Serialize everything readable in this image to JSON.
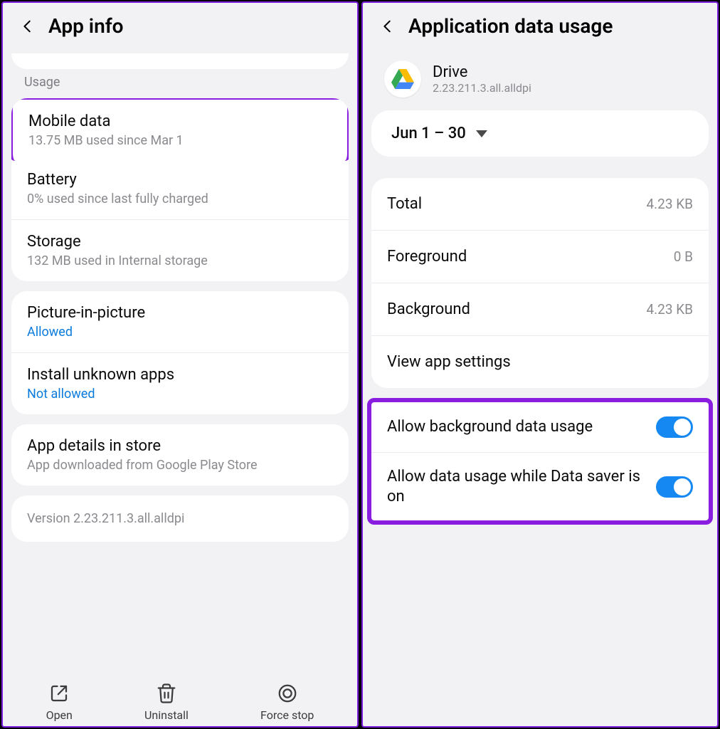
{
  "left": {
    "title": "App info",
    "usage_label": "Usage",
    "mobile_data": {
      "title": "Mobile data",
      "sub": "13.75 MB used since Mar 1"
    },
    "battery": {
      "title": "Battery",
      "sub": "0% used since last fully charged"
    },
    "storage": {
      "title": "Storage",
      "sub": "132 MB used in Internal storage"
    },
    "pip": {
      "title": "Picture-in-picture",
      "sub": "Allowed"
    },
    "unknown": {
      "title": "Install unknown apps",
      "sub": "Not allowed"
    },
    "details": {
      "title": "App details in store",
      "sub": "App downloaded from Google Play Store"
    },
    "version": "Version 2.23.211.3.all.alldpi",
    "actions": {
      "open": "Open",
      "uninstall": "Uninstall",
      "forcestop": "Force stop"
    }
  },
  "right": {
    "title": "Application data usage",
    "app_name": "Drive",
    "app_version": "2.23.211.3.all.alldpi",
    "date_range": "Jun 1 – 30",
    "stats": {
      "total": {
        "label": "Total",
        "value": "4.23 KB"
      },
      "foreground": {
        "label": "Foreground",
        "value": "0 B"
      },
      "background": {
        "label": "Background",
        "value": "4.23 KB"
      }
    },
    "view_settings": "View app settings",
    "toggle_bg": "Allow background data usage",
    "toggle_saver": "Allow data usage while Data saver is on"
  }
}
